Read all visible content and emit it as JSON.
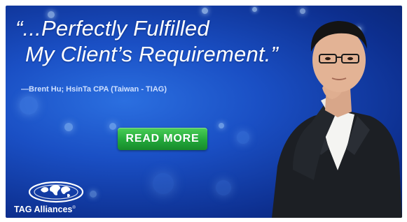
{
  "banner": {
    "quote_line1": "“...Perfectly Fulfilled",
    "quote_line2": "My Client’s Requirement.”",
    "attribution": "—Brent Hu; HsinTa CPA (Taiwan - TIAG)",
    "cta_label": "READ MORE",
    "logo_text": "TAG Alliances",
    "logo_mark": "®",
    "colors": {
      "background": "#1a4fc4",
      "cta": "#23a83a",
      "text": "#ffffff"
    },
    "icons": [
      "globe-logo-icon"
    ]
  }
}
